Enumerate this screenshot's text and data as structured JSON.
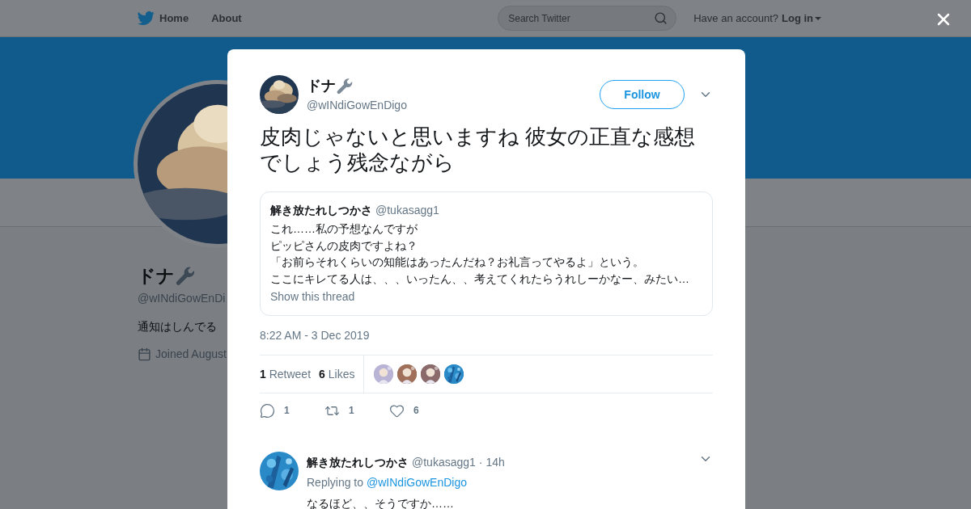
{
  "nav": {
    "links": [
      {
        "label": "Home"
      },
      {
        "label": "About"
      }
    ],
    "search": {
      "placeholder": "Search Twitter"
    },
    "account_prompt": "Have an account?",
    "login": "Log in"
  },
  "profile": {
    "name": "ドナ",
    "handle": "@wINdiGowEnDi",
    "bio": "通知はしんでる",
    "joined": "Joined August"
  },
  "tweet": {
    "name": "ドナ",
    "handle": "@wINdiGowEnDigo",
    "follow": "Follow",
    "text": "皮肉じゃないと思いますね 彼女の正直な感想でしょう残念ながら",
    "quote": {
      "name": "解き放たれしつかさ",
      "handle": "@tukasagg1",
      "lines": [
        "これ……私の予想なんですが",
        "ピッピさんの皮肉ですよね？",
        "「お前らそれくらいの知能はあったんだね？お礼言ってやるよ」という。",
        "ここにキレてる人は、、、いったん、、考えてくれたらうれしーかなー、みたい…"
      ],
      "thread_link": "Show this thread"
    },
    "time": "8:22 AM - 3 Dec 2019",
    "stats": [
      {
        "count": "1",
        "label": "Retweet"
      },
      {
        "count": "6",
        "label": "Likes"
      }
    ],
    "actions": [
      {
        "kind": "reply",
        "count": "1"
      },
      {
        "kind": "retweet",
        "count": "1"
      },
      {
        "kind": "like",
        "count": "6"
      }
    ]
  },
  "reply": {
    "name": "解き放たれしつかさ",
    "handle": "@tukasagg1",
    "time": "· 14h",
    "replying_prefix": "Replying to",
    "replying_to": "@wINdiGowEnDigo",
    "text": "なるほど、、そうですか……"
  }
}
